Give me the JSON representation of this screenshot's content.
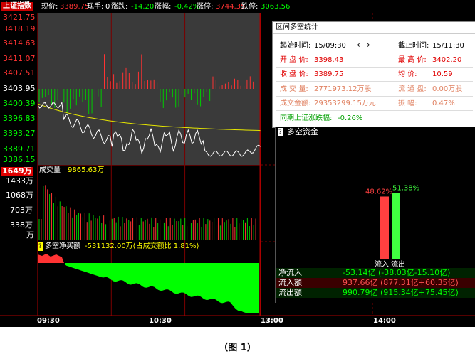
{
  "header": {
    "index_name": "上证指数",
    "price_label": "现价:",
    "price": "3389.75",
    "hand_label": "现手:",
    "hand": "0",
    "change_label": "涨跌:",
    "change": "-14.20",
    "pct_label": "涨幅:",
    "pct": "-0.42%",
    "limit_up_label": "涨停:",
    "limit_up": "3744.35",
    "limit_down_label": "跌停:",
    "limit_down": "3063.56"
  },
  "price_axis": [
    "3421.75",
    "3418.19",
    "3414.63",
    "3411.07",
    "3407.51",
    "3403.95",
    "3400.39",
    "3396.83",
    "3393.27",
    "3389.71",
    "3386.15"
  ],
  "volume": {
    "label": "成交量",
    "value": "9865.63万",
    "current_box": "1649万",
    "axis": [
      "1433万",
      "1068万",
      "703万",
      "338万",
      "万"
    ]
  },
  "flow": {
    "label": "多空净买额",
    "value": "-531132.00万(占成交额比 1.81%)"
  },
  "time_axis": [
    "09:30",
    "10:30",
    "13:00",
    "14:00"
  ],
  "stats_panel": {
    "title": "区间多空统计",
    "start_label": "起始时间:",
    "start_value": "15/09:30",
    "prev": "‹",
    "next": "›",
    "end_label": "截止时间:",
    "end_value": "15/11:30",
    "open_label": "开 盘 价:",
    "open_value": "3398.43",
    "high_label": "最 高 价:",
    "high_value": "3402.20",
    "close_label": "收 盘 价:",
    "close_value": "3389.75",
    "avg_label": "均    价:",
    "avg_value": "10.59",
    "vol_label": "成 交 量:",
    "vol_value": "2771973.12万股",
    "float_label": "流 通 盘:",
    "float_value": "0.00万股",
    "amount_label": "成交金额:",
    "amount_value": "29353299.15万元",
    "amp_label": "振    幅:",
    "amp_value": "0.47%",
    "period_label": "同期上证涨跌幅:",
    "period_value": "-0.26%"
  },
  "money_panel": {
    "title": "多空资金",
    "help": "?",
    "in_pct": "48.62%",
    "in_ratio": 0.4862,
    "out_pct": "51.38%",
    "out_ratio": 0.5138,
    "in_label": "流入",
    "out_label": "流出",
    "rows": [
      {
        "label": "净流入",
        "value": "-53.14亿 (-38.03亿-15.10亿)"
      },
      {
        "label": "流入额",
        "value": "937.66亿 (877.31亿+60.35亿)"
      },
      {
        "label": "流出额",
        "value": "990.79亿 (915.34亿+75.45亿)"
      }
    ]
  },
  "caption": "（图 1）",
  "colors": {
    "up": "#ff3333",
    "down": "#00cc00",
    "yellow": "#ffff00",
    "price_line": "#ffffff",
    "avg_line": "#e6e600",
    "net_flow": "#00ff00"
  }
}
